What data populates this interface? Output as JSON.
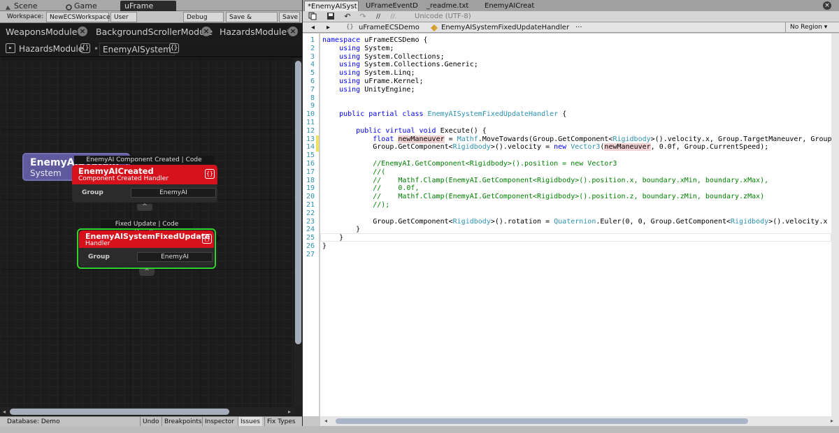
{
  "unity": {
    "tabs": [
      {
        "label": "Scene",
        "icon": "scene-icon"
      },
      {
        "label": "Game",
        "icon": "game-icon"
      },
      {
        "label": "uFrame"
      }
    ],
    "toolbar": {
      "workspace_label": "Workspace:",
      "workspace_value": "NewECSWorkspace",
      "user": "User A",
      "debug_mode": "Debug Mode",
      "save_compile": "Save & Compile",
      "save": "Save"
    },
    "module_tabs": [
      "WeaponsModule*",
      "BackgroundScrollerModule",
      "HazardsModule*"
    ],
    "breadcrumbs": [
      "HazardsModule",
      "EnemyAISystem"
    ],
    "breadcrumb_badge": "{}",
    "nodes": {
      "system": {
        "title": "EnemyAISystem",
        "subtitle": "System",
        "badge": "{}"
      },
      "created": {
        "header": "EnemyAI Component Created | Code Handler",
        "title": "EnemyAICreated",
        "subtitle": "Component Created Handler",
        "badge": "{}",
        "group_label": "Group",
        "group_value": "EnemyAI",
        "toggle": "^"
      },
      "fixed": {
        "header": "Fixed Update | Code Handler",
        "title": "EnemyAISystemFixedUpdate",
        "subtitle": "Handler",
        "badge": "{}",
        "group_label": "Group",
        "group_value": "EnemyAI",
        "toggle": "^",
        "selected_color": "#34d330"
      }
    },
    "status": {
      "database": "Database: Demo",
      "buttons": [
        "Undo",
        "Breakpoints",
        "Inspector",
        "Issues",
        "Fix Types"
      ]
    }
  },
  "editor": {
    "file_tabs": [
      "*EnemyAISyst",
      "UFrameEventD",
      "_readme.txt",
      "EnemyAICreat"
    ],
    "close": "×",
    "encoding": "Unicode (UTF-8)",
    "toolbar_icons": [
      "copy-icon",
      "save-icon",
      "undo-icon",
      "redo-icon",
      "comment-icon",
      "uncomment-icon"
    ],
    "comment_glyph": "//",
    "uncomment_glyph": "//.",
    "nav": {
      "back": "◂",
      "forward": "▸",
      "namespace_badge": "{}",
      "namespace": "uFrameECSDemo",
      "class": "EnemyAISystemFixedUpdateHandler",
      "more": "···",
      "region": "No Region ▾"
    },
    "line_numbers": [
      "1",
      "2",
      "3",
      "4",
      "5",
      "6",
      "7",
      "8",
      "9",
      "10",
      "11",
      "12",
      "13",
      "14",
      "15",
      "16",
      "17",
      "18",
      "19",
      "20",
      "21",
      "22",
      "23",
      "24",
      "25",
      "26",
      "27"
    ],
    "lines": [
      [
        [
          "k",
          "namespace"
        ],
        [
          "d",
          " uFrameECSDemo {"
        ]
      ],
      [
        [
          "d",
          "    "
        ],
        [
          "k",
          "using"
        ],
        [
          "d",
          " System;"
        ]
      ],
      [
        [
          "d",
          "    "
        ],
        [
          "k",
          "using"
        ],
        [
          "d",
          " System.Collections;"
        ]
      ],
      [
        [
          "d",
          "    "
        ],
        [
          "k",
          "using"
        ],
        [
          "d",
          " System.Collections.Generic;"
        ]
      ],
      [
        [
          "d",
          "    "
        ],
        [
          "k",
          "using"
        ],
        [
          "d",
          " System.Linq;"
        ]
      ],
      [
        [
          "d",
          "    "
        ],
        [
          "k",
          "using"
        ],
        [
          "d",
          " uFrame.Kernel;"
        ]
      ],
      [
        [
          "d",
          "    "
        ],
        [
          "k",
          "using"
        ],
        [
          "d",
          " UnityEngine;"
        ]
      ],
      [
        [
          "d",
          ""
        ]
      ],
      [
        [
          "d",
          ""
        ]
      ],
      [
        [
          "d",
          "    "
        ],
        [
          "k",
          "public partial class"
        ],
        [
          "d",
          " "
        ],
        [
          "t",
          "EnemyAISystemFixedUpdateHandler"
        ],
        [
          "d",
          " {"
        ]
      ],
      [
        [
          "d",
          ""
        ]
      ],
      [
        [
          "d",
          "        "
        ],
        [
          "k",
          "public virtual void"
        ],
        [
          "d",
          " Execute() {"
        ]
      ],
      [
        [
          "d",
          "            "
        ],
        [
          "k",
          "float"
        ],
        [
          "d",
          " "
        ],
        [
          "u",
          "newManeuver"
        ],
        [
          "d",
          " = "
        ],
        [
          "t",
          "Mathf"
        ],
        [
          "d",
          ".MoveTowards(Group.GetComponent<"
        ],
        [
          "t",
          "Rigidbody"
        ],
        [
          "d",
          ">().velocity.x, Group.TargetManeuver, Group.Sm"
        ]
      ],
      [
        [
          "d",
          "            Group.GetComponent<"
        ],
        [
          "t",
          "Rigidbody"
        ],
        [
          "d",
          ">().velocity = "
        ],
        [
          "k",
          "new"
        ],
        [
          "d",
          " "
        ],
        [
          "t",
          "Vector3"
        ],
        [
          "d",
          "("
        ],
        [
          "u",
          "newManeuver"
        ],
        [
          "d",
          ", 0.0f, Group.CurrentSpeed);"
        ]
      ],
      [
        [
          "d",
          ""
        ]
      ],
      [
        [
          "d",
          "            "
        ],
        [
          "c",
          "//EnemyAI.GetComponent<Rigidbody>().position = new Vector3"
        ]
      ],
      [
        [
          "d",
          "            "
        ],
        [
          "c",
          "//("
        ]
      ],
      [
        [
          "d",
          "            "
        ],
        [
          "c",
          "//    Mathf.Clamp(EnemyAI.GetComponent<Rigidbody>().position.x, boundary.xMin, boundary.xMax),"
        ]
      ],
      [
        [
          "d",
          "            "
        ],
        [
          "c",
          "//    0.0f,"
        ]
      ],
      [
        [
          "d",
          "            "
        ],
        [
          "c",
          "//    Mathf.Clamp(EnemyAI.GetComponent<Rigidbody>().position.z, boundary.zMin, boundary.zMax)"
        ]
      ],
      [
        [
          "d",
          "            "
        ],
        [
          "c",
          "//);"
        ]
      ],
      [
        [
          "d",
          ""
        ]
      ],
      [
        [
          "d",
          "            Group.GetComponent<"
        ],
        [
          "t",
          "Rigidbody"
        ],
        [
          "d",
          ">().rotation = "
        ],
        [
          "t",
          "Quaternion"
        ],
        [
          "d",
          ".Euler(0, 0, Group.GetComponent<"
        ],
        [
          "t",
          "Rigidbody"
        ],
        [
          "d",
          ">().velocity.x * "
        ]
      ],
      [
        [
          "d",
          "        }"
        ]
      ],
      [
        [
          "d",
          "    }"
        ]
      ],
      [
        [
          "d",
          "}"
        ]
      ],
      [
        [
          "d",
          ""
        ]
      ]
    ],
    "current_line": 25,
    "changed_lines": [
      13,
      14
    ]
  },
  "colors": {
    "keyword": "#0000ff",
    "type": "#2b91af",
    "comment": "#008000",
    "node_red": "#d6111b",
    "system_purple": "#5f5a9e"
  }
}
